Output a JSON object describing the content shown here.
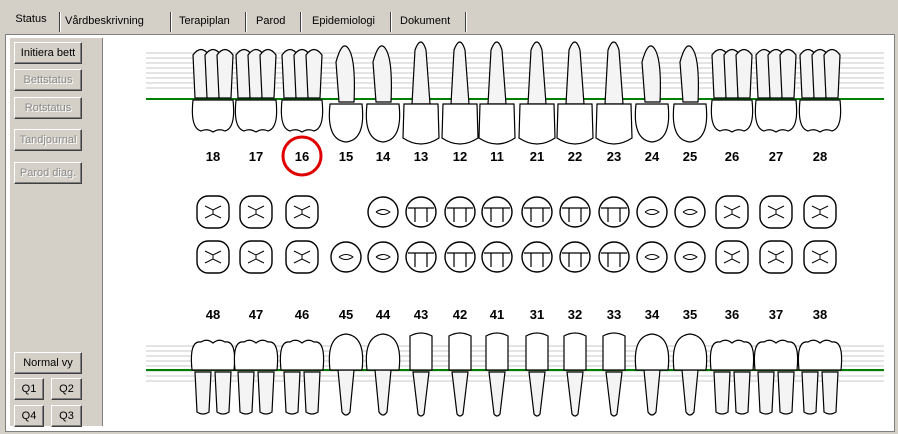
{
  "tabs": [
    "Status",
    "Vårdbeskrivning",
    "Terapiplan",
    "Parod",
    "Epidemiologi",
    "Dokument"
  ],
  "sidebar": {
    "initiera": "Initiera bett",
    "bettstatus": "Bettstatus",
    "rotstatus": "Rotstatus",
    "tandjournal": "Tandjournal",
    "parod": "Parod diag.",
    "normal": "Normal vy",
    "q1": "Q1",
    "q2": "Q2",
    "q4": "Q4",
    "q3": "Q3"
  },
  "upper_teeth": [
    "18",
    "17",
    "16",
    "15",
    "14",
    "13",
    "12",
    "11",
    "21",
    "22",
    "23",
    "24",
    "25",
    "26",
    "27",
    "28"
  ],
  "lower_teeth": [
    "48",
    "47",
    "46",
    "45",
    "44",
    "43",
    "42",
    "41",
    "31",
    "32",
    "33",
    "34",
    "35",
    "36",
    "37",
    "38"
  ],
  "highlighted_tooth": "16",
  "colors": {
    "gum_line": "#008000",
    "highlight": "#e00000",
    "panel": "#d4d0c8"
  }
}
